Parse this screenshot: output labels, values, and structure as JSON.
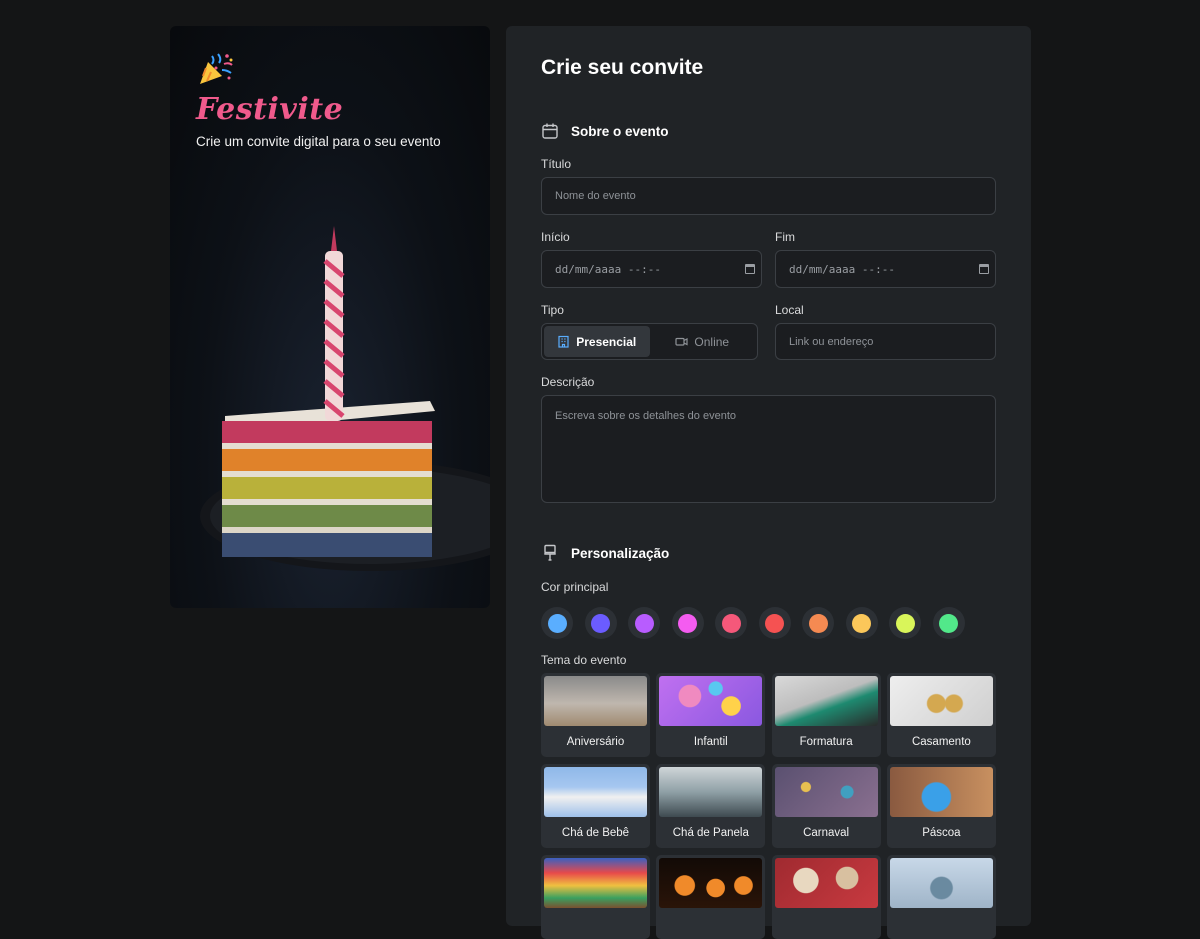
{
  "brand": {
    "name": "Festivite",
    "tagline": "Crie um convite digital para o seu evento",
    "icon": "party-popper-icon"
  },
  "form": {
    "title": "Crie seu convite",
    "about": {
      "heading": "Sobre o evento",
      "icon": "calendar-icon",
      "title_label": "Título",
      "title_placeholder": "Nome do evento",
      "start_label": "Início",
      "start_placeholder": "dd/mm/aaaa --:--",
      "end_label": "Fim",
      "end_placeholder": "dd/mm/aaaa --:--",
      "type_label": "Tipo",
      "type_options": [
        {
          "label": "Presencial",
          "icon": "building-icon",
          "selected": true
        },
        {
          "label": "Online",
          "icon": "video-icon",
          "selected": false
        }
      ],
      "location_label": "Local",
      "location_placeholder": "Link ou endereço",
      "description_label": "Descrição",
      "description_placeholder": "Escreva sobre os detalhes do evento"
    },
    "customization": {
      "heading": "Personalização",
      "icon": "paintbrush-icon",
      "color_label": "Cor principal",
      "colors": [
        "#5aaeff",
        "#6b5cff",
        "#b85cff",
        "#f45cf0",
        "#f5587a",
        "#f55252",
        "#f58a52",
        "#fbc75a",
        "#d9f55a",
        "#52e88a"
      ],
      "theme_label": "Tema do evento",
      "themes": [
        "Aniversário",
        "Infantil",
        "Formatura",
        "Casamento",
        "Chá de Bebê",
        "Chá de Panela",
        "Carnaval",
        "Páscoa",
        "",
        "",
        "",
        ""
      ]
    }
  }
}
